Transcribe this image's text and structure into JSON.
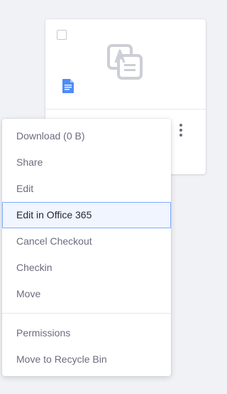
{
  "card": {
    "preview_icon": "documents-media-placeholder-icon",
    "file_type_icon": "document-text-icon",
    "checkbox_checked": false,
    "actions_icon": "ellipsis-v-icon"
  },
  "menu": {
    "groups": [
      [
        {
          "label": "Download (0 B)",
          "active": false
        },
        {
          "label": "Share",
          "active": false
        },
        {
          "label": "Edit",
          "active": false
        },
        {
          "label": "Edit in Office 365",
          "active": true
        },
        {
          "label": "Cancel Checkout",
          "active": false
        },
        {
          "label": "Checkin",
          "active": false
        },
        {
          "label": "Move",
          "active": false
        }
      ],
      [
        {
          "label": "Permissions",
          "active": false
        },
        {
          "label": "Move to Recycle Bin",
          "active": false
        }
      ]
    ]
  },
  "colors": {
    "background": "#f1f2f5",
    "menu_text": "#6b6c7e",
    "active_border": "#80acff",
    "doc_icon": "#4f8cf7"
  }
}
